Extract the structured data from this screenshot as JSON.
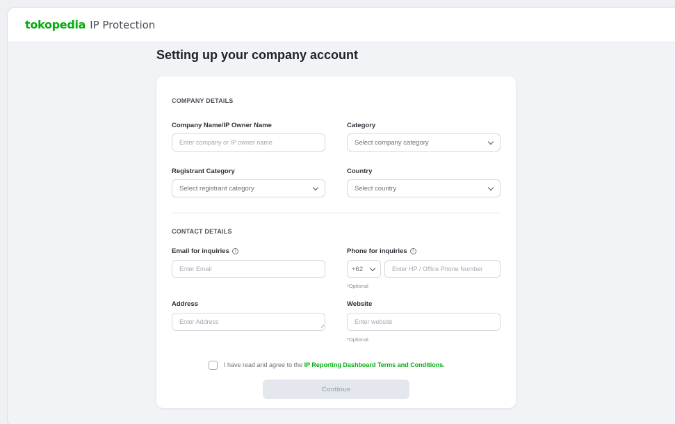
{
  "header": {
    "logo": "tokopedia",
    "product": "IP Protection"
  },
  "page_title": "Setting up your company account",
  "company_details": {
    "section_title": "COMPANY DETAILS",
    "company_name": {
      "label": "Company Name/IP Owner Name",
      "placeholder": "Enter company or IP owner name"
    },
    "category": {
      "label": "Category",
      "placeholder": "Select company category"
    },
    "registrant_category": {
      "label": "Registrant Category",
      "placeholder": "Select registrant category"
    },
    "country": {
      "label": "Country",
      "placeholder": "Select country"
    }
  },
  "contact_details": {
    "section_title": "CONTACT DETAILS",
    "email": {
      "label": "Email for inquiries",
      "placeholder": "Enter Email"
    },
    "phone": {
      "label": "Phone for inquiries",
      "country_code": "+62",
      "placeholder": "Enter HP / Office Phone Number",
      "note": "*Optional"
    },
    "address": {
      "label": "Address",
      "placeholder": "Enter Address"
    },
    "website": {
      "label": "Website",
      "placeholder": "Enter website",
      "note": "*Optional"
    }
  },
  "agreement": {
    "text": "I have read and agree to the ",
    "link": "IP Reporting Dashboard Terms and Conditions."
  },
  "continue_label": "Continue",
  "colors": {
    "brand": "#03ac0e",
    "disabled_button": "#e4e8ee"
  },
  "icons": {
    "info": "info-circle-icon",
    "chevron": "chevron-down-icon"
  }
}
